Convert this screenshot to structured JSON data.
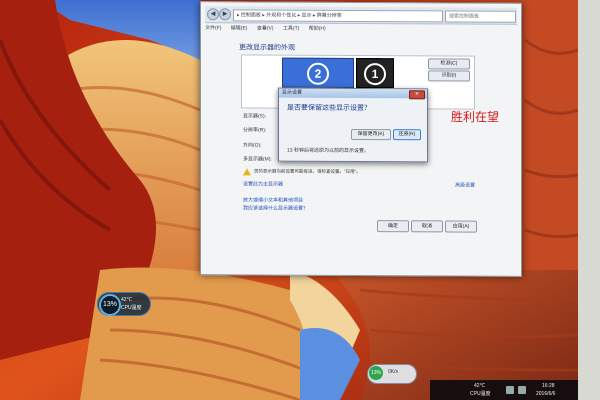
{
  "window": {
    "address_path": "▸ 控制面板 ▸ 外观和个性化 ▸ 显示 ▸ 屏幕分辨率",
    "search_placeholder": "搜索控制面板",
    "menu": [
      "文件(F)",
      "编辑(E)",
      "查看(V)",
      "工具(T)",
      "帮助(H)"
    ],
    "heading": "更改显示器的外观",
    "monitors": [
      {
        "label": "2",
        "selected": true
      },
      {
        "label": "1",
        "selected": false
      }
    ],
    "detect_button": "检测(C)",
    "identify_button": "识别(I)",
    "rows": [
      "显示器(S):",
      "分辨率(R):",
      "方向(O):",
      "多显示器(M):"
    ],
    "warning_text": "您的显示器当前设置可能有误，请检查设置。\"应用\"。",
    "advanced_link": "高级设置",
    "main_display_link": "设置此为主显示器",
    "links": [
      "放大或缩小文本和其他项目",
      "我应该选择什么显示器设置？"
    ],
    "buttons": {
      "ok": "确定",
      "cancel": "取消",
      "apply": "应用(A)"
    }
  },
  "dialog": {
    "title": "显示设置",
    "question": "是否要保留这些显示设置？",
    "keep_button": "保留更改(K)",
    "revert_button": "还原(R)",
    "countdown": "13 秒钟后将还原为以前的显示设置。"
  },
  "overlay_text": "胜利在望",
  "cpu_widget": {
    "value": "13%",
    "temp": "42℃",
    "label": "CPU温度"
  },
  "net_widget": {
    "value": "13%",
    "label": "0K/s"
  },
  "tray": {
    "temp": "42℃",
    "temp_label": "CPU温度",
    "time": "16:28",
    "date": "2016/6/6"
  },
  "colors": {
    "overlay_text": "#d4181b",
    "selected_monitor": "#3a6fd8"
  }
}
